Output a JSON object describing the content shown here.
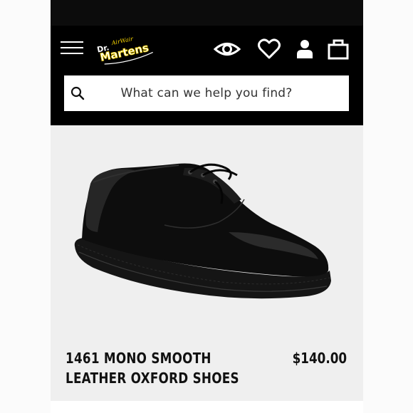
{
  "header": {
    "logo_text_line1": "Dr.",
    "logo_text_line2": "Martens",
    "logo_tagline": "AirWair",
    "menu_icon": "hamburger-menu-icon",
    "icons": [
      "eye-icon",
      "heart-icon",
      "user-icon",
      "shopping-bag-icon"
    ],
    "background": "#000000",
    "logo_accent": "#f5d200"
  },
  "search": {
    "placeholder": "What can we help you find?",
    "icon": "search-icon"
  },
  "product": {
    "title_line1": "1461 MONO SMOOTH",
    "title_line2": "LEATHER OXFORD SHOES",
    "price": "$140.00",
    "image_background": "#efefef"
  }
}
